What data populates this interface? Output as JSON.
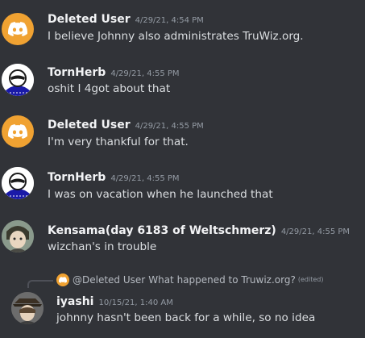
{
  "messages": [
    {
      "author": "Deleted User",
      "timestamp": "4/29/21, 4:54 PM",
      "text": "I believe Johnny also administrates TruWiz.org.",
      "avatar_icon": "discord-logo-icon"
    },
    {
      "author": "TornHerb",
      "timestamp": "4/29/21, 4:55 PM",
      "text": "oshit I 4got about that",
      "avatar_icon": "tornherb-avatar"
    },
    {
      "author": "Deleted User",
      "timestamp": "4/29/21, 4:55 PM",
      "text": "I'm very thankful for that.",
      "avatar_icon": "discord-logo-icon"
    },
    {
      "author": "TornHerb",
      "timestamp": "4/29/21, 4:55 PM",
      "text": "I was on vacation when he launched that",
      "avatar_icon": "tornherb-avatar"
    },
    {
      "author": "Kensama(day 6183 of Weltschmerz)",
      "timestamp": "4/29/21, 4:55 PM",
      "text": "wizchan's in trouble",
      "avatar_icon": "anime-avatar"
    },
    {
      "author": "iyashi",
      "timestamp": "10/15/21, 1:40 AM",
      "text": "johnny hasn't been back for a while, so no idea",
      "avatar_icon": "anime-avatar",
      "reply": {
        "author": "@Deleted User",
        "text": "What happened to Truwiz.org?",
        "edited": "(edited)"
      }
    }
  ],
  "colors": {
    "background": "#313338",
    "discord_orange": "#f0a232",
    "author": "#f2f3f5",
    "text": "#dbdee1",
    "timestamp": "#949ba4"
  }
}
